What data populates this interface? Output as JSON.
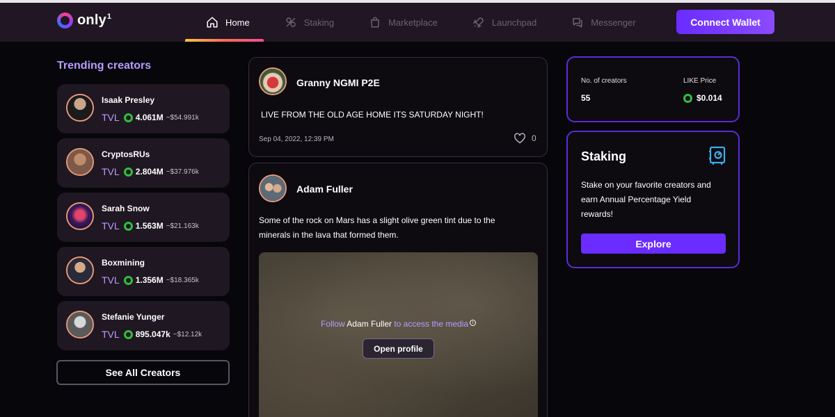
{
  "app": {
    "logo_text": "only",
    "logo_sup": "1"
  },
  "nav": {
    "items": [
      {
        "label": "Home",
        "icon": "home-icon",
        "active": true
      },
      {
        "label": "Staking",
        "icon": "staking-icon",
        "active": false
      },
      {
        "label": "Marketplace",
        "icon": "bag-icon",
        "active": false
      },
      {
        "label": "Launchpad",
        "icon": "rocket-icon",
        "active": false
      },
      {
        "label": "Messenger",
        "icon": "chat-icon",
        "active": false
      }
    ],
    "connect_label": "Connect Wallet"
  },
  "sidebar": {
    "title": "Trending creators",
    "tvl_label": "TVL",
    "creators": [
      {
        "name": "Isaak Presley",
        "tvl": "4.061M",
        "usd": "~$54.991k"
      },
      {
        "name": "CryptosRUs",
        "tvl": "2.804M",
        "usd": "~$37.976k"
      },
      {
        "name": "Sarah Snow",
        "tvl": "1.563M",
        "usd": "~$21.163k"
      },
      {
        "name": "Boxmining",
        "tvl": "1.356M",
        "usd": "~$18.365k"
      },
      {
        "name": "Stefanie Yunger",
        "tvl": "895.047k",
        "usd": "~$12.12k"
      }
    ],
    "see_all_label": "See All Creators"
  },
  "feed": {
    "posts": [
      {
        "author": "Granny NGMI P2E",
        "text": "LIVE FROM THE OLD AGE HOME ITS SATURDAY NIGHT!",
        "date": "Sep 04, 2022, 12:39 PM",
        "likes": "0"
      },
      {
        "author": "Adam Fuller",
        "text_line1": "Some of the rock on Mars has a slight olive green tint due to the",
        "text_line2": "minerals in the lava that formed them.",
        "media": {
          "follow_prefix": "Follow",
          "follow_name": "Adam Fuller",
          "follow_suffix": "to access the media",
          "info": "i",
          "open_profile_label": "Open profile"
        }
      }
    ]
  },
  "stats": {
    "creators_label": "No. of creators",
    "creators_value": "55",
    "price_label": "LIKE Price",
    "price_value": "$0.014"
  },
  "staking": {
    "title": "Staking",
    "desc_line1": "Stake on your favorite creators and",
    "desc_line2": "earn Annual Percentage Yield",
    "desc_line3": "rewards!",
    "explore_label": "Explore"
  },
  "colors": {
    "accent": "#6a2cff",
    "lavender": "#b99cff",
    "coin_green": "#2fc13a",
    "nav_bg": "#211624"
  }
}
